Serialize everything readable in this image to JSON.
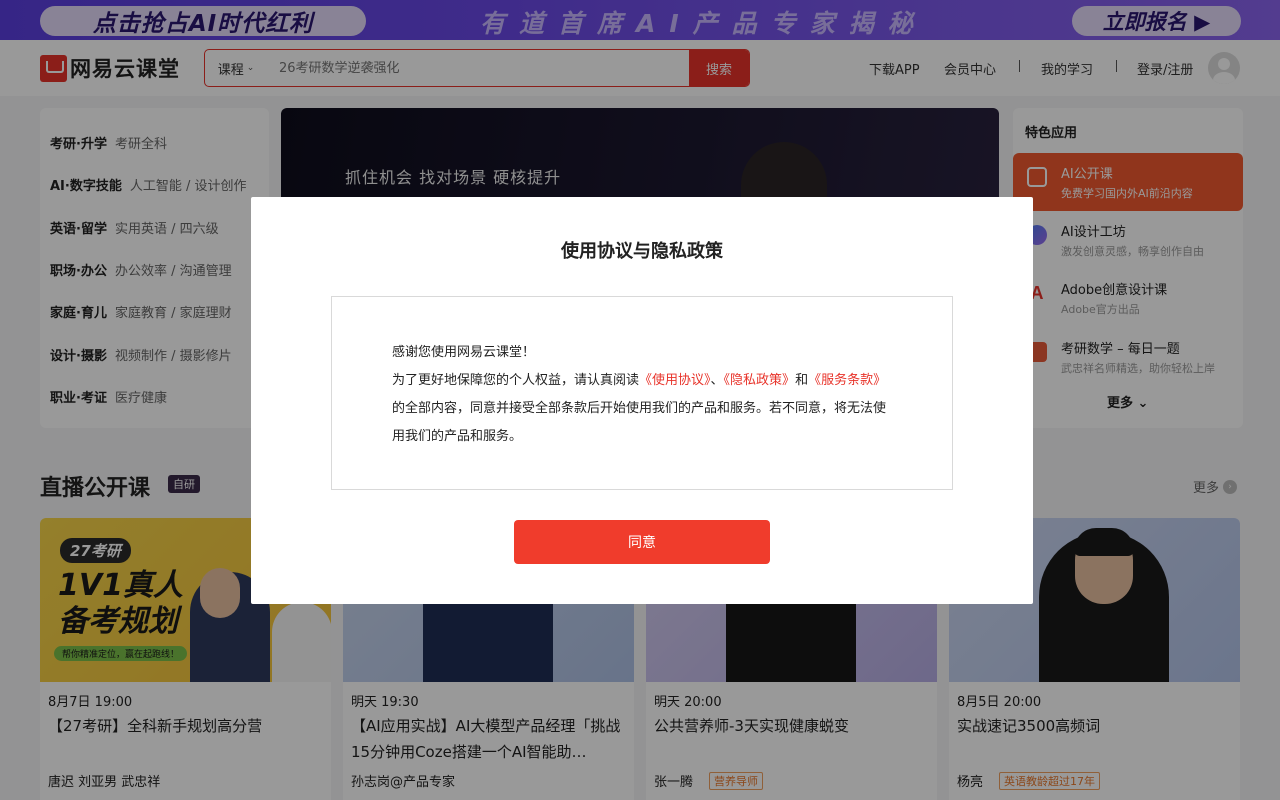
{
  "banner": {
    "left_text": "点击抢占AI时代红利",
    "center_text": "有道首席AI产品专家揭秘",
    "right_text": "立即报名 ▶"
  },
  "header": {
    "logo_text": "网易云课堂",
    "search": {
      "category": "课程",
      "placeholder": "26考研数学逆袭强化",
      "button": "搜索"
    },
    "nav": {
      "download_app": "下载APP",
      "member_center": "会员中心",
      "my_learning": "我的学习",
      "login": "登录/注册"
    }
  },
  "categories": [
    {
      "main": "考研·升学",
      "sub": "考研全科"
    },
    {
      "main": "AI·数字技能",
      "sub": "人工智能 / 设计创作"
    },
    {
      "main": "英语·留学",
      "sub": "实用英语 / 四六级"
    },
    {
      "main": "职场·办公",
      "sub": "办公效率 / 沟通管理"
    },
    {
      "main": "家庭·育儿",
      "sub": "家庭教育 / 家庭理财"
    },
    {
      "main": "设计·摄影",
      "sub": "视频制作 / 摄影修片"
    },
    {
      "main": "职业·考证",
      "sub": "医疗健康"
    }
  ],
  "hero": {
    "tagline": "抓住机会 找对场景 硬核提升"
  },
  "apps": {
    "title": "特色应用",
    "items": [
      {
        "name": "AI公开课",
        "desc": "免费学习国内外AI前沿内容",
        "icon": "tv-icon",
        "color": "#ffffff"
      },
      {
        "name": "AI设计工坊",
        "desc": "激发创意灵感，畅享创作自由",
        "icon": "design-icon",
        "color": "#4a7cf0"
      },
      {
        "name": "Adobe创意设计课",
        "desc": "Adobe官方出品",
        "icon": "adobe-icon",
        "color": "#e8332a"
      },
      {
        "name": "考研数学 – 每日一题",
        "desc": "武忠祥名师精选，助你轻松上岸",
        "icon": "calendar-icon",
        "color": "#e85a3a"
      }
    ],
    "more": "更多"
  },
  "live": {
    "title": "直播公开课",
    "badge": "自研",
    "more": "更多",
    "cards": [
      {
        "time": "8月7日 19:00",
        "title": "【27考研】全科新手规划高分营",
        "teachers": "唐迟  刘亚男  武忠祥",
        "tag": "",
        "poster_badge": "27考研",
        "poster_headline_1": "1V1真人",
        "poster_headline_2": "备考规划",
        "poster_caption": "帮你精准定位，赢在起跑线！"
      },
      {
        "time": "明天 19:30",
        "title": "【AI应用实战】AI大模型产品经理「挑战15分钟用Coze搭建一个AI智能助…",
        "teachers": "孙志岗@产品专家",
        "tag": ""
      },
      {
        "time": "明天 20:00",
        "title": "公共营养师-3天实现健康蜕变",
        "teachers": "张一腾",
        "tag": "营养导师"
      },
      {
        "time": "8月5日 20:00",
        "title": "实战速记3500高频词",
        "teachers": "杨亮",
        "tag": "英语教龄超过17年"
      }
    ]
  },
  "modal": {
    "title": "使用协议与隐私政策",
    "greeting": "感谢您使用网易云课堂！",
    "intro": "为了更好地保障您的个人权益，请认真阅读",
    "link_user_agreement": "《使用协议》",
    "sep1": "、",
    "link_privacy": "《隐私政策》",
    "and": "和",
    "link_terms": "《服务条款》",
    "rest": "的全部内容，同意并接受全部条款后开始使用我们的产品和服务。若不同意，将无法使用我们的产品和服务。",
    "agree_button": "同意"
  },
  "colors": {
    "brand_red": "#e8332a",
    "agree_button": "#f03c2c",
    "banner_purple": "#6a49e6",
    "active_app": "#f0592f"
  }
}
